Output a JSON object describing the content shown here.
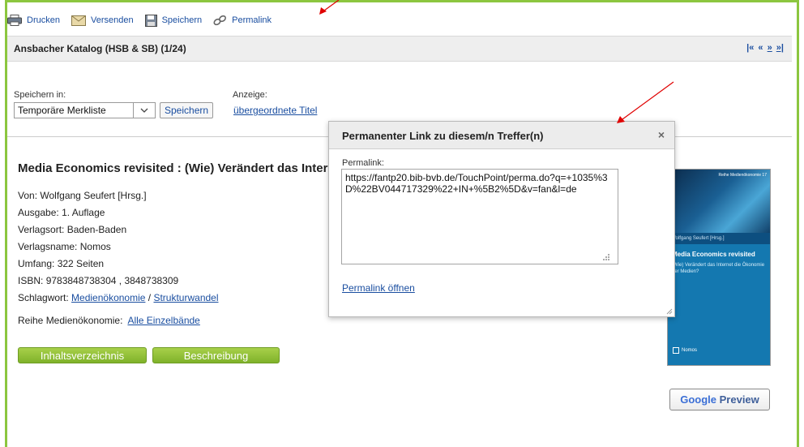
{
  "toolbar": {
    "print_label": "Drucken",
    "send_label": "Versenden",
    "save_label": "Speichern",
    "permalink_label": "Permalink"
  },
  "header": {
    "title": "Ansbacher Katalog (HSB & SB) (1/24)",
    "pager_first": "|«",
    "pager_prev": "«",
    "pager_next": "»",
    "pager_last": "»|"
  },
  "controls": {
    "save_in_label": "Speichern in:",
    "save_in_value": "Temporäre Merkliste",
    "save_button": "Speichern",
    "display_label": "Anzeige:",
    "parent_titles_link": "übergeordnete Titel"
  },
  "record": {
    "title": "Media Economics revisited : (Wie) Verändert das Internet die Ökonomie der Medien?",
    "author_label": "Von:",
    "author": "Wolfgang Seufert [Hrsg.]",
    "edition_label": "Ausgabe:",
    "edition": "1. Auflage",
    "place_label": "Verlagsort:",
    "place": "Baden-Baden",
    "publisher_label": "Verlagsname:",
    "publisher": "Nomos",
    "extent_label": "Umfang:",
    "extent": "322 Seiten",
    "isbn_label": "ISBN:",
    "isbn": "9783848738304 , 3848738309",
    "subject_label": "Schlagwort:",
    "subject_1": "Medienökonomie",
    "subject_sep": "/",
    "subject_2": "Strukturwandel",
    "series_label": "Reihe Medienökonomie:",
    "series_link": "Alle Einzelbände",
    "toc_button": "Inhaltsverzeichnis",
    "desc_button": "Beschreibung"
  },
  "cover": {
    "series": "Reihe Medienökonomie 17",
    "editor": "Wolfgang Seufert [Hrsg.]",
    "title": "Media Economics revisited",
    "subtitle": "(Wie) Verändert das Internet die Ökonomie der Medien?",
    "publisher": "Nomos"
  },
  "google_preview": {
    "google": "Google",
    "preview": "Preview"
  },
  "dialog": {
    "title": "Permanenter Link zu diesem/n Treffer(n)",
    "close": "×",
    "permalink_label": "Permalink:",
    "permalink_value": "https://fantp20.bib-bvb.de/TouchPoint/perma.do?q=+1035%3D%22BV044717329%22+IN+%5B2%5D&v=fan&l=de",
    "open_link": "Permalink öffnen"
  },
  "colors": {
    "frame_green": "#8cc63f",
    "link_blue": "#1a4ea0",
    "button_green": "#8dbe35",
    "arrow_red": "#e00000"
  }
}
